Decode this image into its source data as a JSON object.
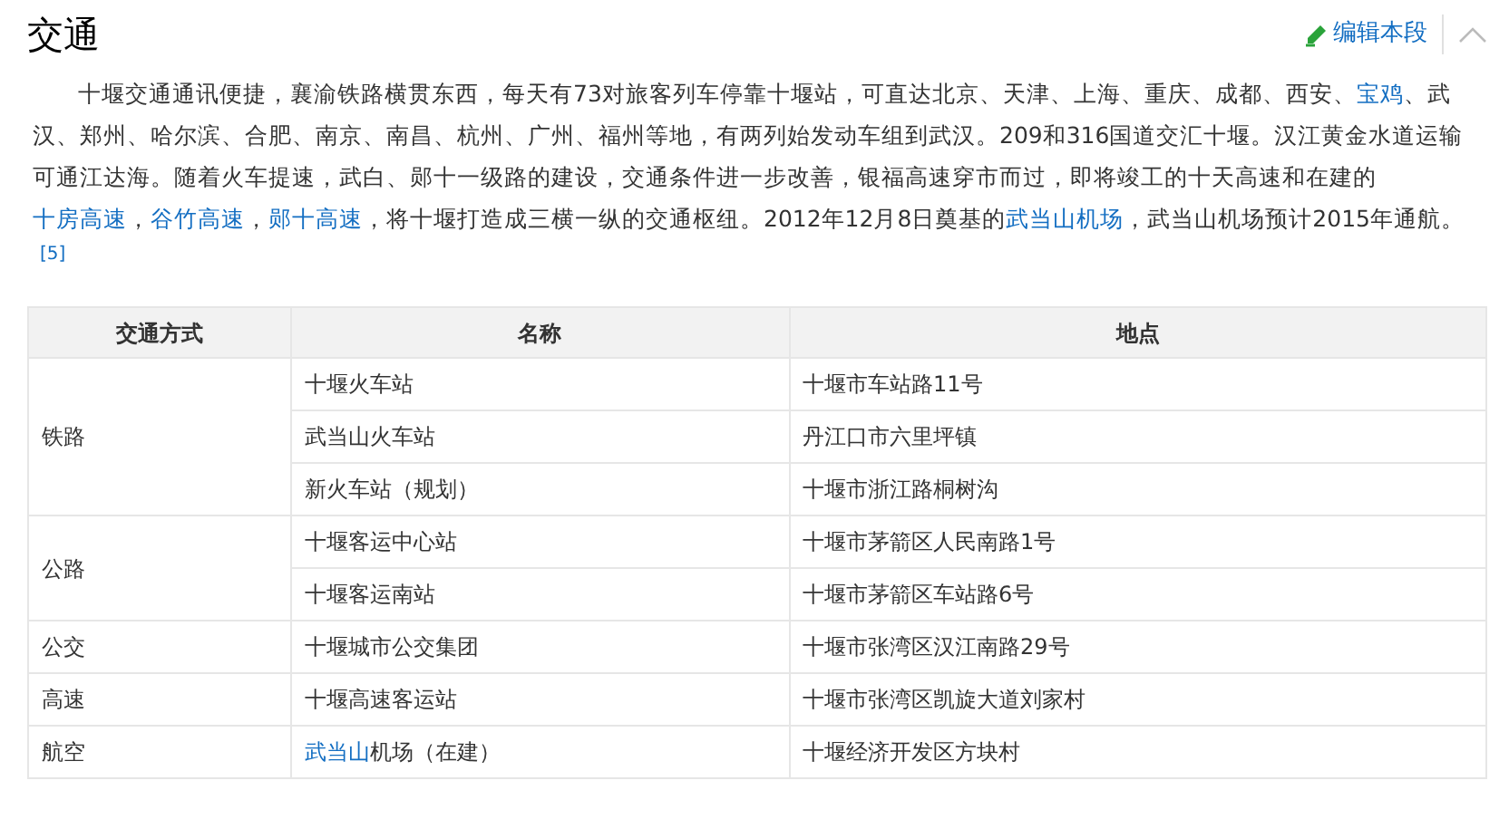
{
  "heading": "交通",
  "edit_link": "编辑本段",
  "paragraph": [
    {
      "text": "十堰交通通讯便捷，襄渝铁路横贯东西，每天有73对旅客列车停靠十堰站，可直达北京、天津、上海、重庆、成都、西安、",
      "link": false
    },
    {
      "text": "宝鸡",
      "link": true
    },
    {
      "text": "、武汉、郑州、哈尔滨、合肥、南京、南昌、杭州、广州、福州等地，有两列始发动车组到武汉。209和316国道交汇十堰。汉江黄金水道运输可通江达海。随着火车提速，武白、郧十一级路的建设，交通条件进一步改善，银福高速穿市而过，即将竣工的十天高速和在建的",
      "link": false
    },
    {
      "text": "十房高速",
      "link": true
    },
    {
      "text": "，",
      "link": false
    },
    {
      "text": "谷竹高速",
      "link": true
    },
    {
      "text": "，",
      "link": false
    },
    {
      "text": "郧十高速",
      "link": true
    },
    {
      "text": "，将十堰打造成三横一纵的交通枢纽。2012年12月8日奠基的",
      "link": false
    },
    {
      "text": "武当山机场",
      "link": true
    },
    {
      "text": "，武当山机场预计2015年通航。",
      "link": false
    }
  ],
  "footnote": "[5]",
  "table": {
    "columns": [
      "交通方式",
      "名称",
      "地点"
    ],
    "groups": [
      {
        "mode": "铁路",
        "rows": [
          {
            "name": [
              {
                "text": "十堰火车站",
                "link": false
              }
            ],
            "place": "十堰市车站路11号"
          },
          {
            "name": [
              {
                "text": "武当山火车站",
                "link": false
              }
            ],
            "place": "丹江口市六里坪镇"
          },
          {
            "name": [
              {
                "text": "新火车站（规划）",
                "link": false
              }
            ],
            "place": "十堰市浙江路桐树沟"
          }
        ]
      },
      {
        "mode": "公路",
        "rows": [
          {
            "name": [
              {
                "text": "十堰客运中心站",
                "link": false
              }
            ],
            "place": "十堰市茅箭区人民南路1号"
          },
          {
            "name": [
              {
                "text": "十堰客运南站",
                "link": false
              }
            ],
            "place": "十堰市茅箭区车站路6号"
          }
        ]
      },
      {
        "mode": "公交",
        "rows": [
          {
            "name": [
              {
                "text": "十堰城市公交集团",
                "link": false
              }
            ],
            "place": "十堰市张湾区汉江南路29号"
          }
        ]
      },
      {
        "mode": "高速",
        "rows": [
          {
            "name": [
              {
                "text": "十堰高速客运站",
                "link": false
              }
            ],
            "place": "十堰市张湾区凯旋大道刘家村"
          }
        ]
      },
      {
        "mode": "航空",
        "rows": [
          {
            "name": [
              {
                "text": "武当山",
                "link": true
              },
              {
                "text": "机场（在建）",
                "link": false
              }
            ],
            "place": "十堰经济开发区方块村"
          }
        ]
      }
    ]
  }
}
